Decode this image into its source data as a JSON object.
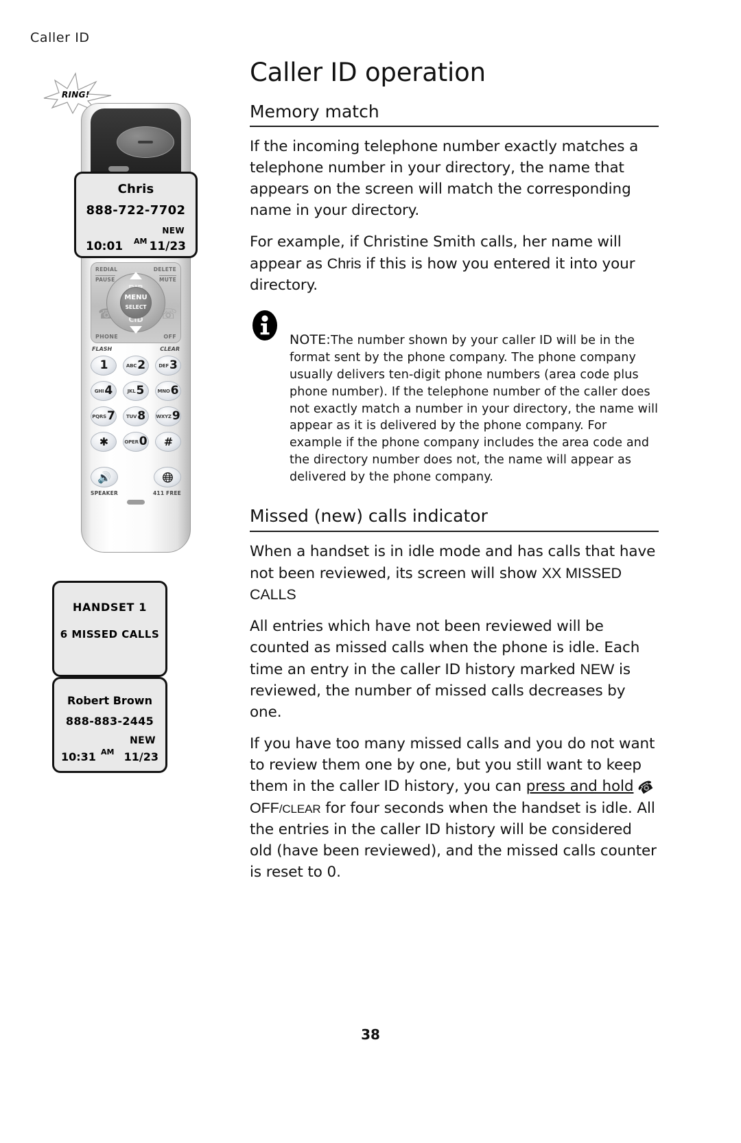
{
  "running_header": "Caller ID",
  "page_number": "38",
  "title": "Caller ID operation",
  "sections": {
    "memory_match": {
      "heading": "Memory match",
      "p1": "If the incoming telephone number exactly matches a telephone number in your directory, the name that appears on the screen will match the corresponding name in your directory.",
      "p2_a": "For example, if Christine Smith calls, her name will appear as ",
      "p2_emph": "Chris",
      "p2_b": " if this is how you entered it into your directory."
    },
    "note": {
      "icon": "info-icon",
      "label": "NOTE:",
      "text": "The number shown by your caller ID will be in the format sent by the phone company. The phone company usually delivers ten-digit phone numbers (area code plus phone number). If the telephone number of the caller does not exactly match a number in your directory, the name will appear as it is delivered by the phone company. For example if the phone company includes the area code and the directory number does not, the name will appear as delivered by the phone company."
    },
    "missed_calls": {
      "heading": "Missed (new) calls indicator",
      "p1_a": "When a handset is in idle mode and has calls that have not been reviewed, its screen will show ",
      "p1_emph": "XX MISSED CALLS",
      "p2_a": "All entries which have not been reviewed will be counted as missed calls when the phone is idle. Each time an entry in the caller ID history marked ",
      "p2_emph": "NEW",
      "p2_b": " is reviewed, the number of missed calls decreases by one.",
      "p3_a": "If you have too many missed calls and you do not want to review them one by one, but you still want to keep them in the caller ID history, you can ",
      "p3_underline": "press and hold",
      "p3_key_icon": "phone-handset-icon",
      "p3_key_off": "OFF",
      "p3_key_slash": "/",
      "p3_key_clear": "CLEAR",
      "p3_b": " for four seconds when the handset is idle. All the entries in the caller ID history will be considered old (have been reviewed), and the missed calls counter is reset to 0."
    }
  },
  "illustration": {
    "ring_burst_label": "RING!",
    "handset_screen": {
      "name": "Chris",
      "number": "888-722-7702",
      "new_flag": "NEW",
      "time": "10:01",
      "ampm": "AM",
      "date": "11/23"
    },
    "soft_keys": {
      "redial": "REDIAL",
      "pause": "PAUSE",
      "delete": "DELETE",
      "mute": "MUTE",
      "phone": "PHONE",
      "off": "OFF",
      "flash": "FLASH",
      "clear": "CLEAR"
    },
    "navigation": {
      "dir": "DIR",
      "menu": "MENU",
      "select": "SELECT",
      "cid": "CID"
    },
    "keypad": [
      [
        {
          "sub": "",
          "digit": "1"
        },
        {
          "sub": "ABC",
          "digit": "2"
        },
        {
          "sub": "DEF",
          "digit": "3"
        }
      ],
      [
        {
          "sub": "GHI",
          "digit": "4"
        },
        {
          "sub": "JKL",
          "digit": "5"
        },
        {
          "sub": "MNO",
          "digit": "6"
        }
      ],
      [
        {
          "sub": "PQRS",
          "digit": "7"
        },
        {
          "sub": "TUV",
          "digit": "8"
        },
        {
          "sub": "WXYZ",
          "digit": "9"
        }
      ],
      [
        {
          "sub": "",
          "digit": "✱"
        },
        {
          "sub": "OPER",
          "digit": "0"
        },
        {
          "sub": "",
          "digit": "#"
        }
      ]
    ],
    "bottom_keys": {
      "speaker_label": "SPEAKER",
      "speaker_icon": "speaker-icon",
      "att_label": "411 FREE",
      "att_icon": "att-globe-icon"
    },
    "lcd_idle": {
      "line1": "HANDSET 1",
      "line2": "6 MISSED CALLS"
    },
    "lcd_record": {
      "name": "Robert Brown",
      "number": "888-883-2445",
      "new_flag": "NEW",
      "time": "10:31",
      "ampm": "AM",
      "date": "11/23"
    }
  }
}
